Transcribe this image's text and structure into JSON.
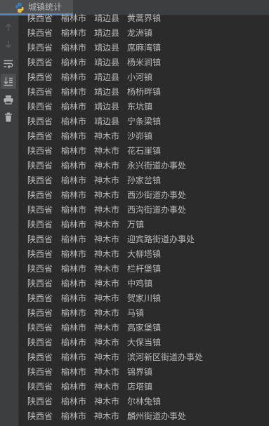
{
  "window": {
    "tab_title": "城镇统计",
    "accent_color": "#4a88c7",
    "background": "#2b2b2b"
  },
  "toolbar": {
    "buttons": [
      {
        "icon": "arrow-up-icon",
        "enabled": false
      },
      {
        "icon": "arrow-down-icon",
        "enabled": false
      },
      {
        "icon": "soft-wrap-icon",
        "enabled": true
      },
      {
        "icon": "scroll-to-end-icon",
        "enabled": true,
        "active": true
      },
      {
        "icon": "print-icon",
        "enabled": true
      },
      {
        "icon": "trash-icon",
        "enabled": true
      }
    ]
  },
  "console": {
    "lines": [
      {
        "province": "陕西省",
        "city": "榆林市",
        "county": "靖边县",
        "town": "黄蒿界镇"
      },
      {
        "province": "陕西省",
        "city": "榆林市",
        "county": "靖边县",
        "town": "龙洲镇"
      },
      {
        "province": "陕西省",
        "city": "榆林市",
        "county": "靖边县",
        "town": "席麻湾镇"
      },
      {
        "province": "陕西省",
        "city": "榆林市",
        "county": "靖边县",
        "town": "杨米涧镇"
      },
      {
        "province": "陕西省",
        "city": "榆林市",
        "county": "靖边县",
        "town": "小河镇"
      },
      {
        "province": "陕西省",
        "city": "榆林市",
        "county": "靖边县",
        "town": "杨桥畔镇"
      },
      {
        "province": "陕西省",
        "city": "榆林市",
        "county": "靖边县",
        "town": "东坑镇"
      },
      {
        "province": "陕西省",
        "city": "榆林市",
        "county": "靖边县",
        "town": "宁条梁镇"
      },
      {
        "province": "陕西省",
        "city": "榆林市",
        "county": "神木市",
        "town": "沙峁镇"
      },
      {
        "province": "陕西省",
        "city": "榆林市",
        "county": "神木市",
        "town": "花石崖镇"
      },
      {
        "province": "陕西省",
        "city": "榆林市",
        "county": "神木市",
        "town": "永兴街道办事处"
      },
      {
        "province": "陕西省",
        "city": "榆林市",
        "county": "神木市",
        "town": "孙家岔镇"
      },
      {
        "province": "陕西省",
        "city": "榆林市",
        "county": "神木市",
        "town": "西沙街道办事处"
      },
      {
        "province": "陕西省",
        "city": "榆林市",
        "county": "神木市",
        "town": "西沟街道办事处"
      },
      {
        "province": "陕西省",
        "city": "榆林市",
        "county": "神木市",
        "town": "万镇"
      },
      {
        "province": "陕西省",
        "city": "榆林市",
        "county": "神木市",
        "town": "迎宾路街道办事处"
      },
      {
        "province": "陕西省",
        "city": "榆林市",
        "county": "神木市",
        "town": "大柳塔镇"
      },
      {
        "province": "陕西省",
        "city": "榆林市",
        "county": "神木市",
        "town": "栏杆堡镇"
      },
      {
        "province": "陕西省",
        "city": "榆林市",
        "county": "神木市",
        "town": "中鸡镇"
      },
      {
        "province": "陕西省",
        "city": "榆林市",
        "county": "神木市",
        "town": "贺家川镇"
      },
      {
        "province": "陕西省",
        "city": "榆林市",
        "county": "神木市",
        "town": "马镇"
      },
      {
        "province": "陕西省",
        "city": "榆林市",
        "county": "神木市",
        "town": "高家堡镇"
      },
      {
        "province": "陕西省",
        "city": "榆林市",
        "county": "神木市",
        "town": "大保当镇"
      },
      {
        "province": "陕西省",
        "city": "榆林市",
        "county": "神木市",
        "town": "滨河新区街道办事处"
      },
      {
        "province": "陕西省",
        "city": "榆林市",
        "county": "神木市",
        "town": "锦界镇"
      },
      {
        "province": "陕西省",
        "city": "榆林市",
        "county": "神木市",
        "town": "店塔镇"
      },
      {
        "province": "陕西省",
        "city": "榆林市",
        "county": "神木市",
        "town": "尔林兔镇"
      },
      {
        "province": "陕西省",
        "city": "榆林市",
        "county": "神木市",
        "town": "麟州街道办事处"
      }
    ]
  }
}
